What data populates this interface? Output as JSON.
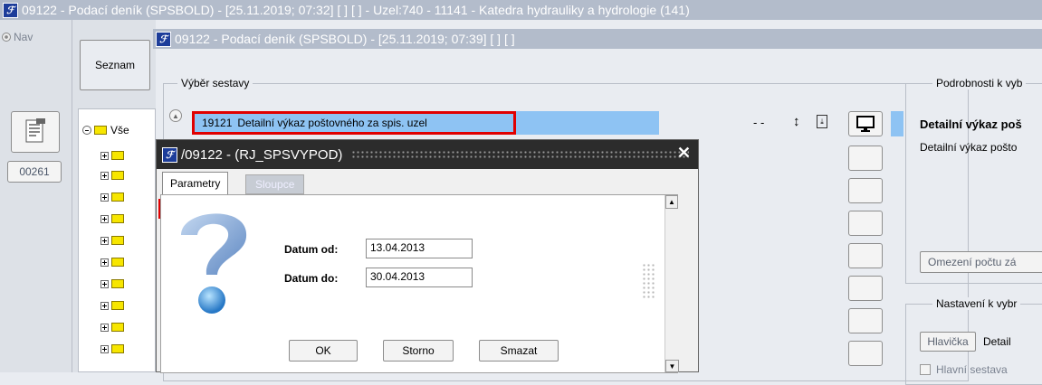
{
  "main_window": {
    "title": "09122 - Podací deník (SPSBOLD) - [25.11.2019; 07:32]  [ ]  [ ] - Uzel:740 - 11141 - Katedra hydrauliky a hydrologie (141)"
  },
  "left_panel": {
    "nav_label": "Nav",
    "record_number": "00261"
  },
  "inner_window": {
    "title": "09122 - Podací deník (SPSBOLD) - [25.11.2019; 07:39]  [ ]  [ ]",
    "seznam_button": "Seznam",
    "tree_root": "Vše",
    "group_vyber": "Výběr sestavy",
    "report_code": "19121",
    "report_name": "Detailní výkaz poštovného za spis. uzel",
    "dashes": "-   -",
    "group_podrobnosti": "Podrobnosti k vyb",
    "detail_title": "Detailní výkaz poš",
    "detail_text": "Detailní výkaz pošto",
    "omezeni_button": "Omezení počtu zá",
    "group_nastaveni": "Nastavení k vybr",
    "hlavicka_button": "Hlavička",
    "hlavicka_detail": "Detail",
    "hlavni_sestava": "Hlavní sestava"
  },
  "dialog": {
    "title": "/09122 - (RJ_SPSVYPOD)",
    "tabs": [
      {
        "label": "Parametry",
        "active": true
      },
      {
        "label": "Sloupce",
        "active": false
      }
    ],
    "date_from_label": "Datum od:",
    "date_from_value": "13.04.2013",
    "date_to_label": "Datum do:",
    "date_to_value": "30.04.2013",
    "ok_button": "OK",
    "storno_button": "Storno",
    "smazat_button": "Smazat"
  },
  "colors": {
    "highlight": "#8ec3f3",
    "selection_border": "#e00000",
    "title_bar": "#b3bccb",
    "dialog_title": "#2c2c2c"
  }
}
